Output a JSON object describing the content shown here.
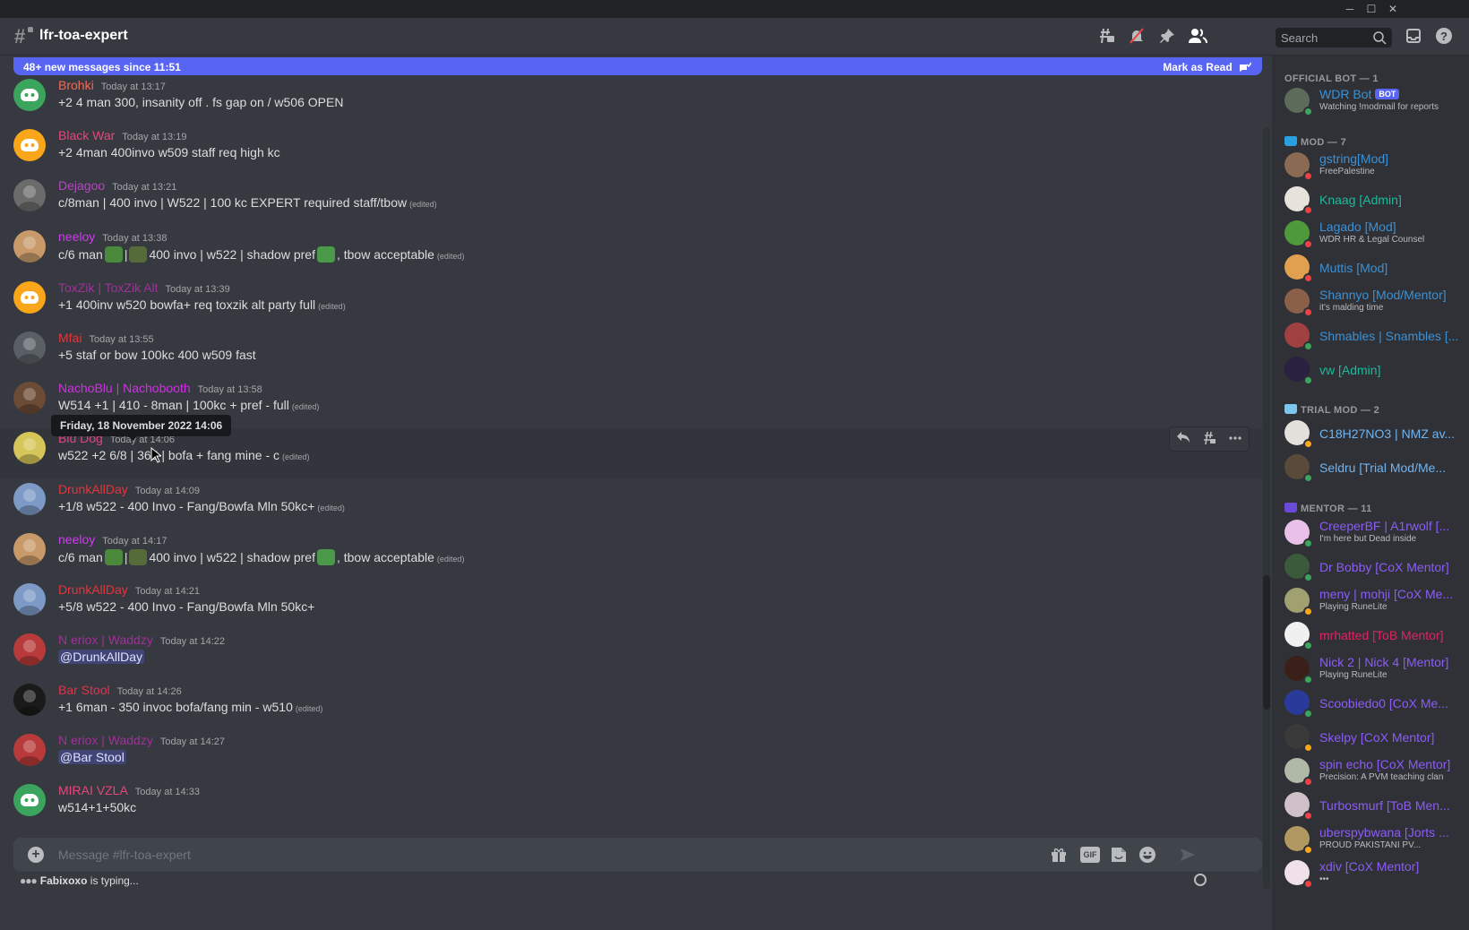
{
  "window": {
    "minimize": "─",
    "maximize": "☐",
    "close": "✕"
  },
  "header": {
    "channel_name": "lfr-toa-expert",
    "search_placeholder": "Search",
    "icons": [
      "threads-icon",
      "muted-bell-icon",
      "pin-icon",
      "member-list-icon",
      "inbox-icon",
      "help-icon"
    ]
  },
  "new_messages_bar": {
    "label": "48+ new messages since 11:51",
    "mark_as_read": "Mark as Read"
  },
  "colors": {
    "accent": "#5865f2",
    "bg_chat": "#36393f",
    "bg_members": "#2f3136",
    "online": "#3ba55d",
    "dnd": "#ed4245",
    "idle": "#faa81a"
  },
  "messages": [
    {
      "author": "Brohki",
      "color": "#f06a5a",
      "timestamp": "Today at 13:17",
      "content": "+2 4 man 300, insanity off . fs  gap on / w506 OPEN",
      "edited": "",
      "avatar": "#3ba55d",
      "avatar_type": "discord"
    },
    {
      "author": "Black War",
      "color": "#e8457e",
      "timestamp": "Today at 13:19",
      "content": "+2 4man 400invo w509 staff req high kc",
      "edited": "",
      "avatar": "#faa61a",
      "avatar_type": "discord"
    },
    {
      "author": "Dejagoo",
      "color": "#b845c1",
      "timestamp": "Today at 13:21",
      "content": "c/8man | 400 invo | W522 | 100 kc EXPERT required staff/tbow",
      "edited": "(edited)",
      "avatar": "#6b6b6b",
      "avatar_type": "photo"
    },
    {
      "author": "neeloy",
      "color": "#d13bf0",
      "timestamp": "Today at 13:38",
      "content_parts": [
        "c/6 man",
        "|",
        "400 invo | w522 | shadow pref",
        ", tbow acceptable"
      ],
      "edited": "(edited)",
      "avatar": "#c89a6a",
      "avatar_type": "photo"
    },
    {
      "author": "ToxZik | ToxZik Alt",
      "color": "#a0309a",
      "timestamp": "Today at 13:39",
      "content": "+1 400inv w520 bowfa+ req toxzik alt party full",
      "edited": "(edited)",
      "avatar": "#faa61a",
      "avatar_type": "discord"
    },
    {
      "author": "Mfai",
      "color": "#e8333d",
      "timestamp": "Today at 13:55",
      "content": "+5 staf or bow 100kc 400 w509 fast",
      "edited": "",
      "avatar": "#5a5f66",
      "avatar_type": "photo"
    },
    {
      "author": "NachoBlu | Nachobooth",
      "color": "#d22fe6",
      "timestamp": "Today at 13:58",
      "content": "W514 +1 | 410 - 8man | 100kc + pref - full",
      "edited": "(edited)",
      "avatar": "#6b4a36",
      "avatar_type": "photo"
    },
    {
      "author": "Blu Dog",
      "color": "#e0448a",
      "timestamp": "Today at 14:06",
      "content": "w522 +2 6/8 | 365 | bofa + fang mine - c",
      "edited": "(edited)",
      "avatar": "#d6c65a",
      "avatar_type": "photo"
    },
    {
      "author": "DrunkAllDay",
      "color": "#e8333d",
      "timestamp": "Today at 14:09",
      "content": "+1/8 w522 - 400 Invo - Fang/Bowfa Mln 50kc+",
      "edited": "(edited)",
      "avatar": "#7d9ac6",
      "avatar_type": "photo"
    },
    {
      "author": "neeloy",
      "color": "#d13bf0",
      "timestamp": "Today at 14:17",
      "content_parts": [
        "c/6 man",
        "|",
        "400 invo | w522 | shadow pref",
        ", tbow acceptable"
      ],
      "edited": "(edited)",
      "avatar": "#c89a6a",
      "avatar_type": "photo"
    },
    {
      "author": "DrunkAllDay",
      "color": "#e8333d",
      "timestamp": "Today at 14:21",
      "content": "+5/8 w522 - 400 Invo - Fang/Bowfa Mln 50kc+",
      "edited": "",
      "avatar": "#7d9ac6",
      "avatar_type": "photo"
    },
    {
      "author": "N eriox | Waddzy",
      "color": "#a0309a",
      "timestamp": "Today at 14:22",
      "mention": "@DrunkAllDay",
      "edited": "",
      "avatar": "#b83a3a",
      "avatar_type": "photo"
    },
    {
      "author": "Bar Stool",
      "color": "#e0344e",
      "timestamp": "Today at 14:26",
      "content": "+1 6man - 350 invoc bofa/fang min - w510",
      "edited": "(edited)",
      "avatar": "#1a1a1a",
      "avatar_type": "photo"
    },
    {
      "author": "N eriox | Waddzy",
      "color": "#a0309a",
      "timestamp": "Today at 14:27",
      "mention": "@Bar Stool",
      "edited": "",
      "avatar": "#b83a3a",
      "avatar_type": "photo"
    },
    {
      "author": "MIRAI VZLA",
      "color": "#e8457e",
      "timestamp": "Today at 14:33",
      "content": "w514+1+50kc",
      "edited": "",
      "avatar": "#3ba55d",
      "avatar_type": "discord"
    }
  ],
  "tooltip": "Friday, 18 November 2022 14:06",
  "hover_toolbar": {
    "reply": "reply-icon",
    "thread": "create-thread-icon",
    "more": "more-options-icon"
  },
  "composer": {
    "placeholder": "Message #lfr-toa-expert",
    "gif_label": "GIF",
    "icons": [
      "gift-icon",
      "gif-icon",
      "sticker-icon",
      "emoji-icon",
      "send-icon"
    ]
  },
  "typing": {
    "user": "Fabixoxo",
    "suffix": " is typing..."
  },
  "members": {
    "groups": [
      {
        "title": "OFFICIAL BOT — 1",
        "crown": ""
      },
      {
        "title": "MOD — 7",
        "crown": "#2aa0e0"
      },
      {
        "title": "TRIAL MOD — 2",
        "crown": "#7cc7f0"
      },
      {
        "title": "MENTOR — 11",
        "crown": "#6a4ad6"
      }
    ],
    "list": [
      {
        "name": "WDR Bot",
        "color": "#3b91d6",
        "sub": "Watching !modmail for reports",
        "status": "online",
        "avatar": "#5d6b5a",
        "bot": "BOT"
      },
      {
        "name": "gstring[Mod]",
        "color": "#3b91d6",
        "sub": "FreePalestine",
        "status": "dnd",
        "avatar": "#8a6a52"
      },
      {
        "name": "Knaag [Admin]",
        "color": "#1abc9c",
        "sub": "",
        "status": "dnd",
        "avatar": "#e8e2dc"
      },
      {
        "name": "Lagado [Mod]",
        "color": "#3b91d6",
        "sub": "WDR HR & Legal Counsel",
        "status": "dnd",
        "avatar": "#4e9a3a"
      },
      {
        "name": "Muttis [Mod]",
        "color": "#3b91d6",
        "sub": "",
        "status": "dnd",
        "avatar": "#e0a050"
      },
      {
        "name": "Shannyo [Mod/Mentor]",
        "color": "#3b91d6",
        "sub": "it's malding time",
        "status": "dnd",
        "avatar": "#8a6048"
      },
      {
        "name": "Shmables | Snambles [...",
        "color": "#3b91d6",
        "sub": "",
        "status": "online",
        "avatar": "#a04040"
      },
      {
        "name": "vw [Admin]",
        "color": "#1abc9c",
        "sub": "",
        "status": "online",
        "avatar": "#2a2040"
      },
      {
        "name": "C18H27NO3 | NMZ av...",
        "color": "#70b4f0",
        "sub": "",
        "status": "idle",
        "avatar": "#e4e0dc"
      },
      {
        "name": "Seldru [Trial Mod/Me...",
        "color": "#70b4f0",
        "sub": "",
        "status": "online",
        "avatar": "#5a4a3a"
      },
      {
        "name": "CreeperBF | A1rwolf [...",
        "color": "#8b5cf6",
        "sub": "I'm here but Dead inside",
        "status": "online",
        "avatar": "#e8c0e8"
      },
      {
        "name": "Dr Bobby [CoX Mentor]",
        "color": "#8b5cf6",
        "sub": "",
        "status": "online",
        "avatar": "#3a5a3a"
      },
      {
        "name": "meny | mohji [CoX Me...",
        "color": "#8b5cf6",
        "sub": "Playing RuneLite",
        "status": "idle",
        "avatar": "#a0a070"
      },
      {
        "name": "mrhatted [ToB Mentor]",
        "color": "#e0245e",
        "sub": "",
        "status": "online",
        "avatar": "#f0f0f0"
      },
      {
        "name": "Nick 2 | Nick 4 [Mentor]",
        "color": "#8b5cf6",
        "sub": "Playing RuneLite",
        "status": "online",
        "avatar": "#3a2018"
      },
      {
        "name": "Scoobiedo0 [CoX Me...",
        "color": "#8b5cf6",
        "sub": "",
        "status": "online",
        "avatar": "#2a3a9a"
      },
      {
        "name": "Skelpy [CoX Mentor]",
        "color": "#8b5cf6",
        "sub": "",
        "status": "idle",
        "avatar": "#3a3a3a"
      },
      {
        "name": "spin echo [CoX Mentor]",
        "color": "#8b5cf6",
        "sub": "Precision: A PVM teaching clan",
        "status": "dnd",
        "avatar": "#b0b8a8"
      },
      {
        "name": "Turbosmurf [ToB Men...",
        "color": "#8b5cf6",
        "sub": "",
        "status": "dnd",
        "avatar": "#d0c0c8"
      },
      {
        "name": "uberspybwana [Jorts ...",
        "color": "#8b5cf6",
        "sub": "PROUD PAKISTANI PV...",
        "status": "idle",
        "avatar": "#b09860"
      },
      {
        "name": "xdiv [CoX Mentor]",
        "color": "#8b5cf6",
        "sub": "•••",
        "status": "dnd",
        "avatar": "#f0e0e8"
      }
    ]
  }
}
